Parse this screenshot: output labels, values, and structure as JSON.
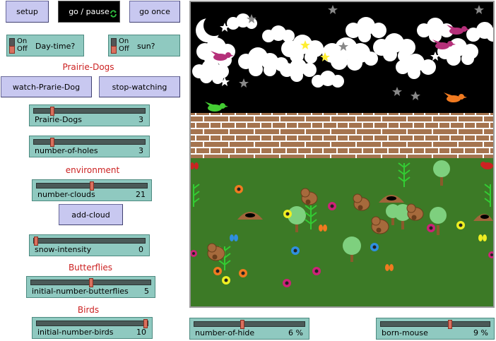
{
  "buttons": {
    "setup": "setup",
    "go_pause": "go / pause",
    "go_once": "go once",
    "watch": "watch-Prarie-Dog",
    "stop": "stop-watching",
    "add_cloud": "add-cloud"
  },
  "switches": {
    "on": "On",
    "off": "Off",
    "daytime_label": "Day-time?",
    "sun_label": "sun?"
  },
  "sections": {
    "prairie_dogs": "Prairie-Dogs",
    "environment": "environment",
    "butterflies": "Butterflies",
    "birds": "Birds"
  },
  "sliders": {
    "prairie_dogs": {
      "label": "Prairie-Dogs",
      "value": "3",
      "fraction": 0.15
    },
    "holes": {
      "label": "number-of-holes",
      "value": "3",
      "fraction": 0.15
    },
    "clouds": {
      "label": "number-clouds",
      "value": "21",
      "fraction": 0.5
    },
    "snow": {
      "label": "snow-intensity",
      "value": "0",
      "fraction": 0.0
    },
    "butterflies": {
      "label": "initial-number-butterflies",
      "value": "5",
      "fraction": 0.5
    },
    "birds": {
      "label": "initial-number-birds",
      "value": "10",
      "fraction": 1.0
    },
    "hide": {
      "label": "number-of-hide",
      "value": "6 %",
      "fraction": 0.43
    },
    "born": {
      "label": "born-mouse",
      "value": "9 %",
      "fraction": 0.64
    }
  },
  "colors": {
    "button": "#c8c8f0",
    "widget": "#8fc9c0",
    "section_label": "#cc2222",
    "sky": "#000000",
    "brick": "#a5744f",
    "grass": "#3c7a26"
  }
}
